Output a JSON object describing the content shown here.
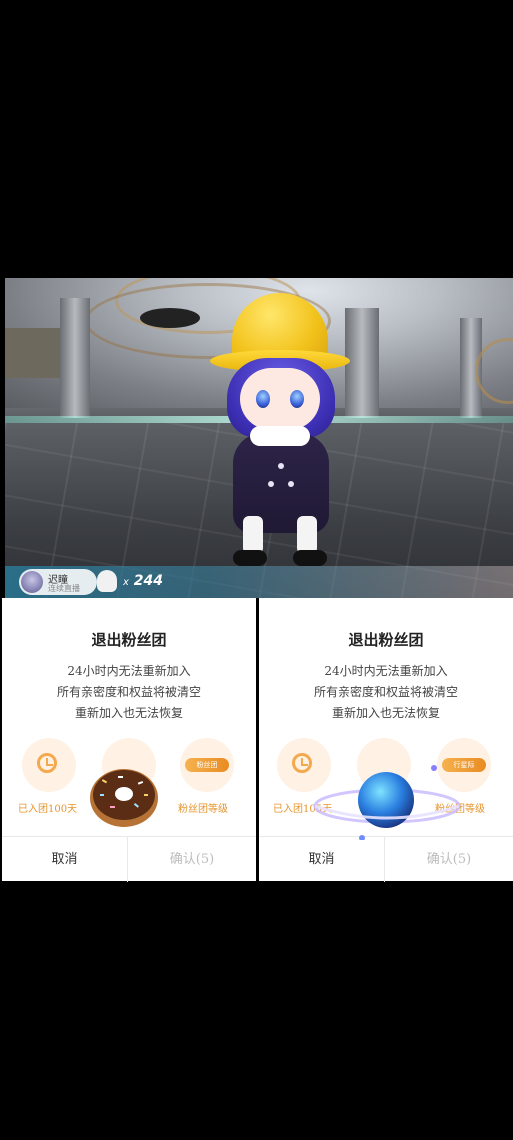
{
  "stream": {
    "anchor_name": "迟瞳",
    "anchor_sub": "连续直播",
    "gift_count": "244",
    "gift_prefix": "x"
  },
  "dialogs": [
    {
      "title": "退出粉丝团",
      "lines": [
        "24小时内无法重新加入",
        "所有亲密度和权益将被清空",
        "重新加入也无法恢复"
      ],
      "stat_days": "已入团100天",
      "stat_level": "粉丝团等级",
      "badge_text": "粉丝团",
      "cancel": "取消",
      "confirm": "确认(5)"
    },
    {
      "title": "退出粉丝团",
      "lines": [
        "24小时内无法重新加入",
        "所有亲密度和权益将被清空",
        "重新加入也无法恢复"
      ],
      "stat_days": "已入团105天",
      "stat_level": "粉丝团等级",
      "badge_text": "行星际",
      "cancel": "取消",
      "confirm": "确认(5)"
    }
  ],
  "colors": {
    "accent": "#e6952e",
    "badge": "#f5b24f",
    "disabled": "#bdbdbd"
  },
  "icons": {
    "clock": "clock-icon",
    "donut": "donut-gift-icon",
    "planet": "planet-gift-icon",
    "ghost": "ghost-icon"
  }
}
